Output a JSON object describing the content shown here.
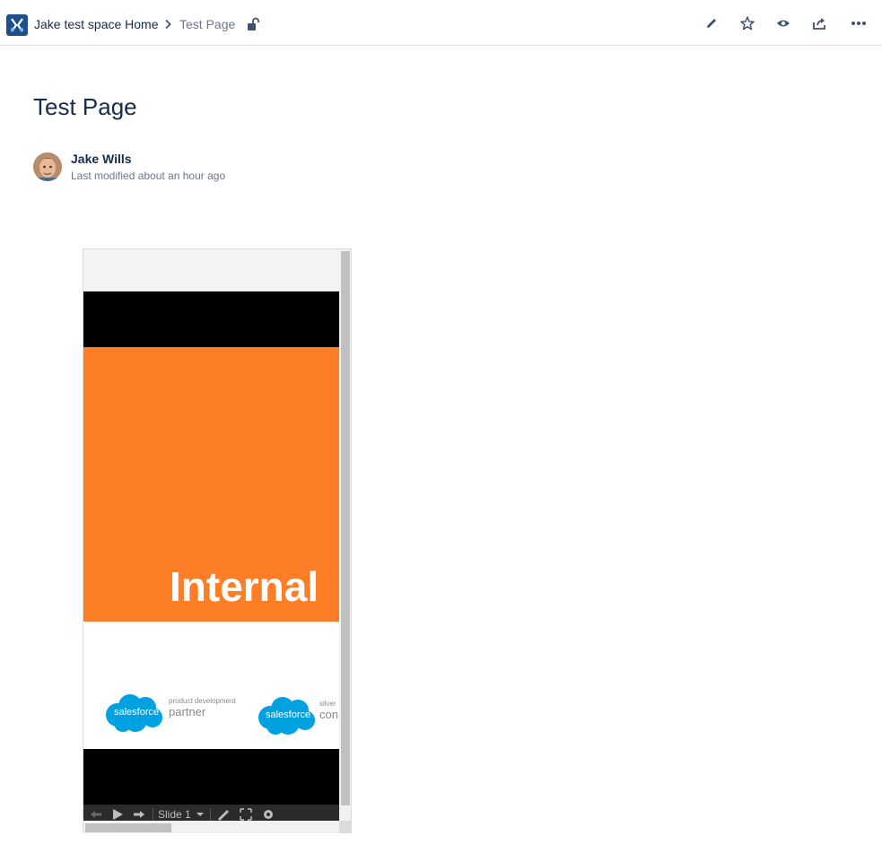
{
  "breadcrumb": {
    "space_home": "Jake test space Home",
    "current_page": "Test Page"
  },
  "toolbar": {
    "edit_icon": "pencil-icon",
    "star_icon": "star-icon",
    "watch_icon": "eye-icon",
    "share_icon": "share-icon",
    "more_icon": "more-icon"
  },
  "page": {
    "title": "Test Page",
    "author": "Jake Wills",
    "last_modified": "Last modified about an hour ago"
  },
  "embed": {
    "slide_title": "Internal",
    "logo1": {
      "brand": "salesforce",
      "small_text": "product development",
      "large_text": "partner"
    },
    "logo2": {
      "brand": "salesforce",
      "small_text": "silver",
      "large_text": "con"
    },
    "slide_selector": "Slide 1"
  },
  "colors": {
    "slide_orange": "#fd7e27",
    "salesforce_blue": "#00a1e0",
    "space_logo_bg": "#1f4f8a",
    "text_primary": "#172b4d",
    "text_secondary": "#6b778c"
  }
}
